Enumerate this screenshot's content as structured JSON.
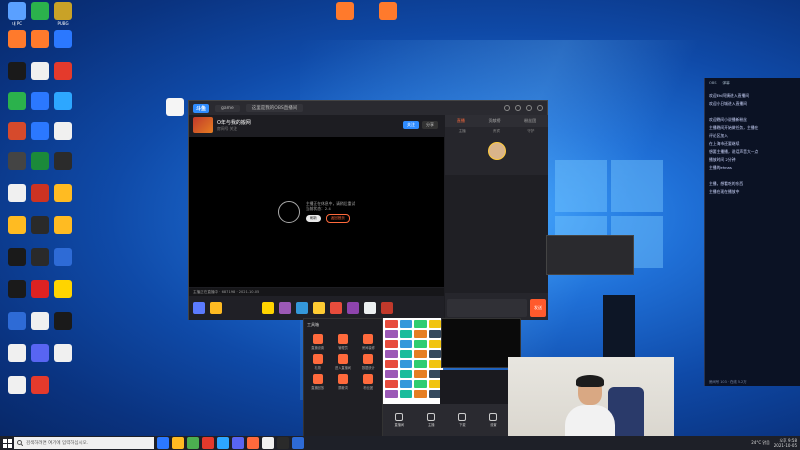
{
  "desktop": {
    "icons": [
      {
        "label": "내 PC",
        "color": "#5aa0ff"
      },
      {
        "label": "",
        "color": "#2bb24c"
      },
      {
        "label": "PUBG",
        "color": "#c9a227"
      },
      {
        "label": "",
        "color": "#ff7a2c"
      },
      {
        "label": "",
        "color": "#ff7a2c"
      },
      {
        "label": "",
        "color": "#2b78ff"
      },
      {
        "label": "",
        "color": "#1a1a1a"
      },
      {
        "label": "",
        "color": "#f0f0f0"
      },
      {
        "label": "",
        "color": "#e43a2c"
      },
      {
        "label": "",
        "color": "#2bb24c"
      },
      {
        "label": "",
        "color": "#2b78ff"
      },
      {
        "label": "",
        "color": "#2da7ff"
      },
      {
        "label": "",
        "color": "#d64a2c"
      },
      {
        "label": "",
        "color": "#2b78ff"
      },
      {
        "label": "",
        "color": "#f0f0f0"
      },
      {
        "label": "",
        "color": "#444"
      },
      {
        "label": "",
        "color": "#1b8a3a"
      },
      {
        "label": "",
        "color": "#2b2b2b"
      },
      {
        "label": "",
        "color": "#f0f0f0"
      },
      {
        "label": "",
        "color": "#cc3322"
      },
      {
        "label": "",
        "color": "#ffbb22"
      },
      {
        "label": "",
        "color": "#ffbb22"
      },
      {
        "label": "",
        "color": "#2a2a2a"
      },
      {
        "label": "",
        "color": "#ffbb22"
      },
      {
        "label": "",
        "color": "#1a1a1a"
      },
      {
        "label": "",
        "color": "#2a2a2a"
      },
      {
        "label": "",
        "color": "#2e6bd6"
      },
      {
        "label": "",
        "color": "#1a1a1a"
      },
      {
        "label": "",
        "color": "#d22"
      },
      {
        "label": "",
        "color": "#ffd400"
      },
      {
        "label": "",
        "color": "#2e6bd6"
      },
      {
        "label": "",
        "color": "#f0f0f0"
      },
      {
        "label": "",
        "color": "#1a1a1a"
      },
      {
        "label": "",
        "color": "#f0f0f0"
      },
      {
        "label": "",
        "color": "#5865f2"
      },
      {
        "label": "",
        "color": "#f0f0f0"
      },
      {
        "label": "",
        "color": "#f0f0f0"
      },
      {
        "label": "",
        "color": "#e43a2c"
      }
    ]
  },
  "stream_app": {
    "logo": "斗鱼",
    "tab_title": "这里是我的OBS直播间",
    "search_placeholder": "game",
    "streamer_name": "O年与我的搬网",
    "streamer_sub": "房间号  关注",
    "follow_btn": "关注",
    "share_btn": "分享",
    "video_message_line1": "主播正在休息中，请稍后重试",
    "video_message_line2": "当前状态：2.4",
    "video_btn_primary": "刷新",
    "video_btn_secondary": "返回首页",
    "status_text": "主播正在直播中 · 687198 · 2021.10.05",
    "side_tabs": [
      "直播",
      "贡献榜",
      "粉丝团"
    ],
    "side_sub_tabs": [
      "主播",
      "贵宾",
      "守护"
    ],
    "send_label": "发送"
  },
  "chat_window": {
    "header_items": [
      "OBS",
      "弹幕"
    ],
    "lines": [
      "欢迎Ehi阿姨进入直播间",
      "欢迎小日城进入直播间",
      "",
      "欢迎晚间小说播新粉丝",
      "主播晚间开始做任务，主播在",
      "评论区加入",
      "在上海市还要继续",
      "想要主播播，说话声音大一点",
      "播放时间 2分钟",
      "主播的ehnas",
      "",
      "主播，想看吃的东西",
      "主播在现在播放中"
    ],
    "footer": "房间号 103 · 在线 5.2万"
  },
  "tool_panel": {
    "title": "工具箱",
    "items": [
      {
        "label": "直播设置"
      },
      {
        "label": "管理员"
      },
      {
        "label": "房间装修"
      },
      {
        "label": "礼物"
      },
      {
        "label": "进入直播间"
      },
      {
        "label": "数据统计"
      },
      {
        "label": "直播回放"
      },
      {
        "label": "屏蔽词"
      },
      {
        "label": "粉丝团"
      }
    ]
  },
  "bottom_toolbar": {
    "items": [
      {
        "label": "直播间"
      },
      {
        "label": "主播"
      },
      {
        "label": "下载"
      },
      {
        "label": "设置"
      }
    ]
  },
  "taskbar": {
    "search_placeholder": "검색하려면 여기에 입력하십시오.",
    "apps": [
      {
        "color": "#2b78ff"
      },
      {
        "color": "#ffbb22"
      },
      {
        "color": "#4caf50"
      },
      {
        "color": "#e43a2c"
      },
      {
        "color": "#2da7ff"
      },
      {
        "color": "#5865f2"
      },
      {
        "color": "#ff6a3c"
      },
      {
        "color": "#f0f0f0"
      },
      {
        "color": "#2a2a2a"
      },
      {
        "color": "#2e6bd6"
      }
    ],
    "weather": "24°C 맑음",
    "time": "오후 9:58",
    "date": "2021-10-05"
  },
  "accent_colors": {
    "brand": "#ff6a3c",
    "blue": "#2f8cff"
  }
}
